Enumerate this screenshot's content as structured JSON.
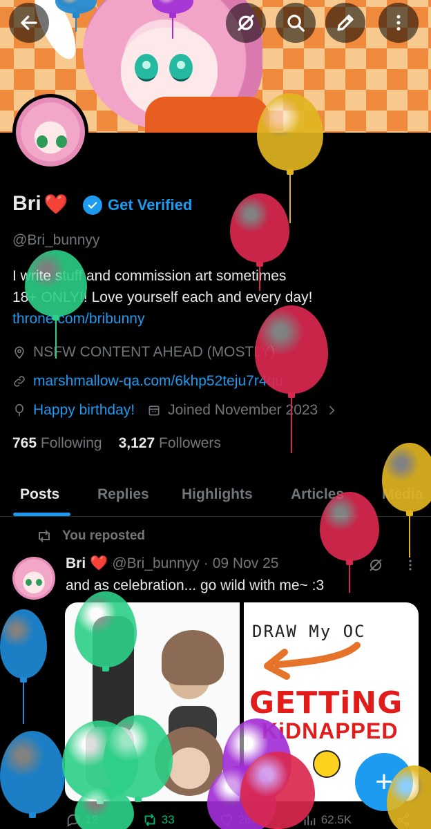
{
  "top_bar": {
    "back_icon": "arrow-left-icon",
    "icons": [
      "hide-icon",
      "search-icon",
      "edit-icon",
      "more-vertical-icon"
    ]
  },
  "profile": {
    "name": "Bri",
    "name_emoji": "❤️",
    "get_verified": "Get Verified",
    "handle": "@Bri_bunnyy",
    "bio_line1": "I write stuff and commission art sometimes",
    "bio_line2": "18+ ONLY!! Love yourself each and every day!",
    "bio_link": "throne.com/bribunny",
    "location": "NSFW CONTENT AHEAD (MOSTLY)",
    "website": "marshmallow-qa.com/6khp52teju7r4qu",
    "birthday": "Happy birthday!",
    "joined": "Joined November 2023",
    "following_count": "765",
    "following_label": "Following",
    "followers_count": "3,127",
    "followers_label": "Followers"
  },
  "tabs": [
    {
      "label": "Posts",
      "active": true
    },
    {
      "label": "Replies",
      "active": false
    },
    {
      "label": "Highlights",
      "active": false
    },
    {
      "label": "Articles",
      "active": false
    },
    {
      "label": "Media",
      "active": false
    }
  ],
  "post": {
    "repost_label": "You reposted",
    "author": "Bri",
    "author_emoji": "❤️",
    "handle": "@Bri_bunnyy",
    "separator": "·",
    "date": "09 Nov 25",
    "text": "and as celebration... go wild with me~ :3",
    "image_right_title": "DRAW My OC",
    "image_right_getting": "GETTiNG",
    "image_right_kidnapped": "KiDNAPPED",
    "replies": "12",
    "reposts": "33",
    "likes": "265",
    "views": "62.5K"
  },
  "fab_label": "+",
  "colors": {
    "accent": "#1d9bf0",
    "background": "#000000",
    "muted": "#71767b",
    "repost_green": "#00ba7c"
  }
}
